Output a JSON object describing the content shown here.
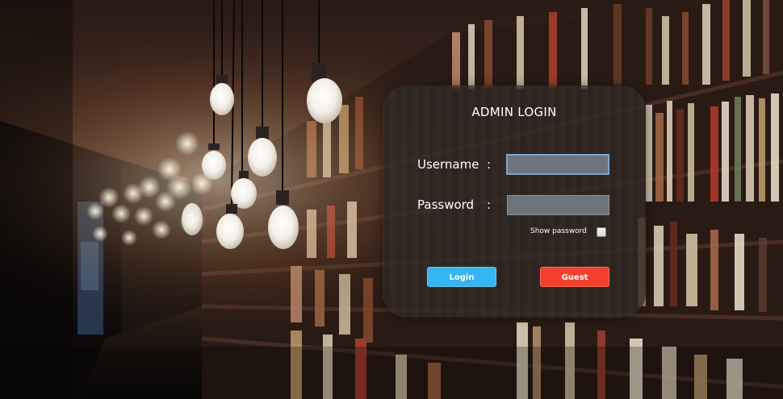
{
  "colors": {
    "login_button": "#35b6f0",
    "guest_button": "#f2402c",
    "input_fill": "#6e747c",
    "panel": "#302824"
  },
  "login": {
    "title": "ADMIN LOGIN",
    "username_label": "Username",
    "password_label": "Password",
    "separator": ":",
    "username_value": "",
    "password_value": "",
    "show_password_label": "Show password",
    "show_password_checked": false,
    "login_button": "Login",
    "guest_button": "Guest"
  }
}
